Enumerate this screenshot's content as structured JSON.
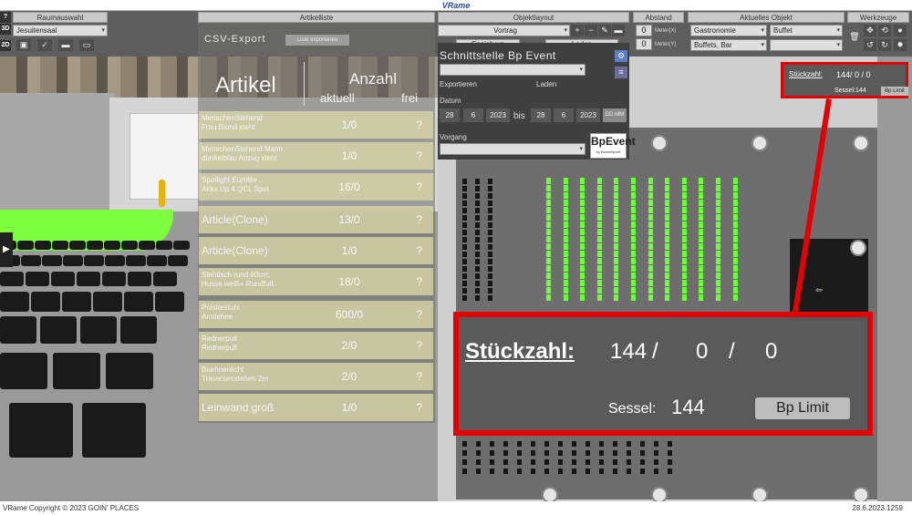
{
  "window": {
    "title": "VRame"
  },
  "toolbar": {
    "help": "?",
    "mode_3d": "3D",
    "mode_2d": "2D",
    "raumauswahl": {
      "header": "Raumauswahl",
      "selected": "Jesuitensaal"
    },
    "artikelliste": {
      "header": "Artikelliste"
    },
    "objektlayout": {
      "header": "Objektlayout",
      "selected": "Vortrag",
      "speichern": "Speichern",
      "laden": "Laden"
    },
    "abstand": {
      "header": "Abstand",
      "value_x": "0",
      "value_y": "0",
      "label_x": "Meter(X)",
      "label_y": "Meter(Y)"
    },
    "aktuelles_objekt": {
      "header": "Aktuelles Objekt",
      "cat1": "Gastronomie",
      "cat2": "Buffet",
      "cat3": "Buffets, Bar",
      "cat4": ""
    },
    "werkzeuge": {
      "header": "Werkzeuge"
    }
  },
  "artikel": {
    "csv_title": "CSV-Export",
    "csv_button": "Liste exportieren",
    "col_artikel": "Artikel",
    "col_anzahl": "Anzahl",
    "col_aktuell": "aktuell",
    "col_frei": "frei",
    "rows": [
      {
        "name": "MenschenStehend\nFrau Blond steht",
        "value": "1/0",
        "frei": "?",
        "big": false
      },
      {
        "name": "MenschenStehend Mann\ndunkelblau Anzug steht",
        "value": "1/0",
        "frei": "?",
        "big": false
      },
      {
        "name": "Spotlight Eurolite\nAkku Up 4 QCL Spot",
        "value": "16/0",
        "frei": "?",
        "big": false
      },
      {
        "name": "Article(Clone)",
        "value": "13/0",
        "frei": "?",
        "big": true
      },
      {
        "name": "Article(Clone)",
        "value": "1/0",
        "frei": "?",
        "big": true
      },
      {
        "name": "Stehtisch rund 80cm,\nHusse weiß+ Rundfuß",
        "value": "18/0",
        "frei": "?",
        "big": false
      },
      {
        "name": "Polsterstuhl\nArmlehne",
        "value": "600/0",
        "frei": "?",
        "big": false
      },
      {
        "name": "Rednerpult\nRednerpult",
        "value": "2/0",
        "frei": "?",
        "big": false
      },
      {
        "name": "Buehnenlicht\nTraversenstehen 2m",
        "value": "2/0",
        "frei": "?",
        "big": false
      },
      {
        "name": "Leinwand groß",
        "value": "1/0",
        "frei": "?",
        "big": true
      }
    ]
  },
  "bp": {
    "title": "Schnittstelle Bp Event",
    "exportieren": "Exportieren",
    "laden": "Laden",
    "datum": "Datum",
    "from_d": "28",
    "from_m": "6",
    "from_y": "2023",
    "bis": "bis",
    "to_d": "28",
    "to_m": "6",
    "to_y": "2023",
    "date_fmt": "DD.MM",
    "vorgang": "Vorgang",
    "logo": "BpEvent",
    "logo_sub": "by Bankettprofi"
  },
  "stueckzahl": {
    "label": "Stückzahl:",
    "value_mini": "144/  0  /  0",
    "v1": "144",
    "v2": "0",
    "v3": "0",
    "sep": "/",
    "sessel_label": "Sessel:",
    "sessel_value": "144",
    "limit_button": "Bp Limit"
  },
  "status": {
    "copyright": "VRame Copyright © 2023 GOIN' PLACES",
    "date": "28.6.2023.1259"
  },
  "colors": {
    "accent_red": "#e40000",
    "seat_green": "#6bff3c"
  }
}
